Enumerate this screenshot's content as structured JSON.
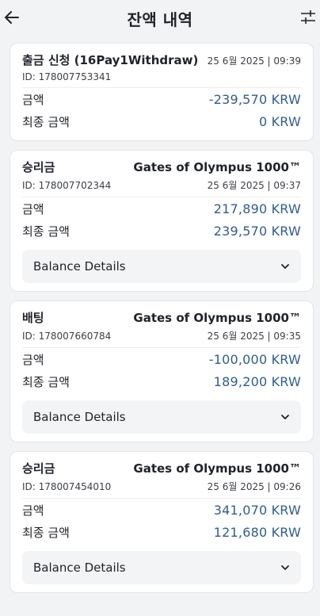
{
  "header": {
    "back_icon": "arrow-left-icon",
    "title": "잔액 내역",
    "filter_icon": "sliders-icon"
  },
  "transactions": [
    {
      "type": "출금 신청 (16Pay1Withdraw)",
      "game": "",
      "id": "ID: 178007753341",
      "date": "25 6월 2025 | 09:39",
      "amount_label": "금액",
      "amount": "-239,570 KRW",
      "final_label": "최종 금액",
      "final": "0 KRW",
      "details_label": ""
    },
    {
      "type": "승리금",
      "game": "Gates of Olympus 1000™",
      "id": "ID: 178007702344",
      "date": "25 6월 2025 | 09:37",
      "amount_label": "금액",
      "amount": "217,890 KRW",
      "final_label": "최종 금액",
      "final": "239,570 KRW",
      "details_label": "Balance Details"
    },
    {
      "type": "배팅",
      "game": "Gates of Olympus 1000™",
      "id": "ID: 178007660784",
      "date": "25 6월 2025 | 09:35",
      "amount_label": "금액",
      "amount": "-100,000 KRW",
      "final_label": "최종 금액",
      "final": "189,200 KRW",
      "details_label": "Balance Details"
    },
    {
      "type": "승리금",
      "game": "Gates of Olympus 1000™",
      "id": "ID: 178007454010",
      "date": "25 6월 2025 | 09:26",
      "amount_label": "금액",
      "amount": "341,070 KRW",
      "final_label": "최종 금액",
      "final": "121,680 KRW",
      "details_label": "Balance Details"
    }
  ],
  "colors": {
    "background": "#f2f3f5",
    "card": "#ffffff",
    "value_blue": "#2e5d8f",
    "text": "#1f2329"
  }
}
